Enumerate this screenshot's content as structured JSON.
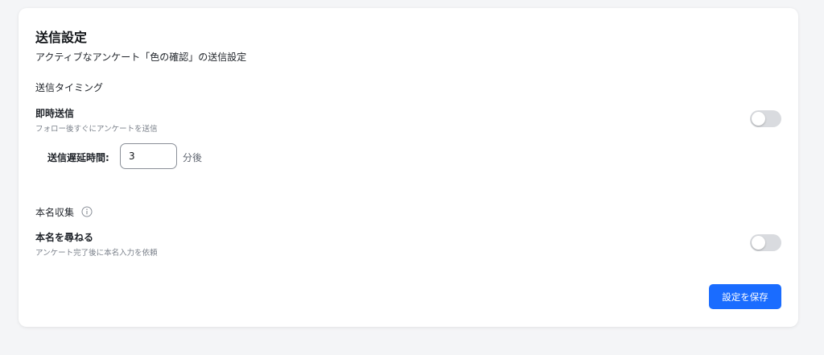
{
  "panel": {
    "title": "送信設定",
    "subtitle": "アクティブなアンケート「色の確認」の送信設定"
  },
  "timing": {
    "section_label": "送信タイミング",
    "immediate": {
      "title": "即時送信",
      "description": "フォロー後すぐにアンケートを送信",
      "enabled": false
    },
    "delay": {
      "label": "送信遅延時間:",
      "value": "3",
      "unit": "分後"
    }
  },
  "real_name": {
    "section_label": "本名収集",
    "info_icon": "info-circle-icon",
    "ask": {
      "title": "本名を尋ねる",
      "description": "アンケート完了後に本名入力を依頼",
      "enabled": false
    }
  },
  "actions": {
    "save_label": "設定を保存"
  },
  "colors": {
    "accent": "#1a6cff",
    "toggle_off": "#d9dbdf"
  }
}
